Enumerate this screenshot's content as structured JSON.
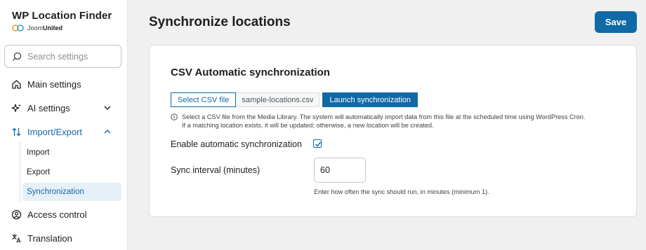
{
  "brand": {
    "title": "WP Location Finder",
    "company_light": "Joom",
    "company_bold": "United"
  },
  "search": {
    "placeholder": "Search settings",
    "icon": "search-icon"
  },
  "sidebar": {
    "items": [
      {
        "label": "Main settings",
        "icon": "home-icon"
      },
      {
        "label": "AI settings",
        "icon": "sparkle-icon"
      },
      {
        "label": "Import/Export",
        "icon": "arrows-updown-icon",
        "active": true
      },
      {
        "label": "Access control",
        "icon": "user-circle-icon"
      },
      {
        "label": "Translation",
        "icon": "translate-icon"
      }
    ],
    "subitems": [
      {
        "label": "Import"
      },
      {
        "label": "Export"
      },
      {
        "label": "Synchronization",
        "selected": true
      }
    ]
  },
  "header": {
    "title": "Synchronize locations",
    "save_label": "Save"
  },
  "card": {
    "title": "CSV Automatic synchronization",
    "select_label": "Select CSV file",
    "file_name": "sample-locations.csv",
    "launch_label": "Launch synchronization",
    "help_line1": "Select a CSV file from the Media Library. The system will automatically import data from this file at the scheduled time using WordPress Cron.",
    "help_line2": "If a matching location exists, it will be updated; otherwise, a new location will be created.",
    "enable_label": "Enable automatic synchronization",
    "enable_checked": true,
    "interval_label": "Sync interval (minutes)",
    "interval_value": "60",
    "interval_hint": "Enter how often the sync should run, in minutes (minimum 1)."
  },
  "colors": {
    "accent": "#0f6aa6",
    "background": "#f0f0f1"
  }
}
